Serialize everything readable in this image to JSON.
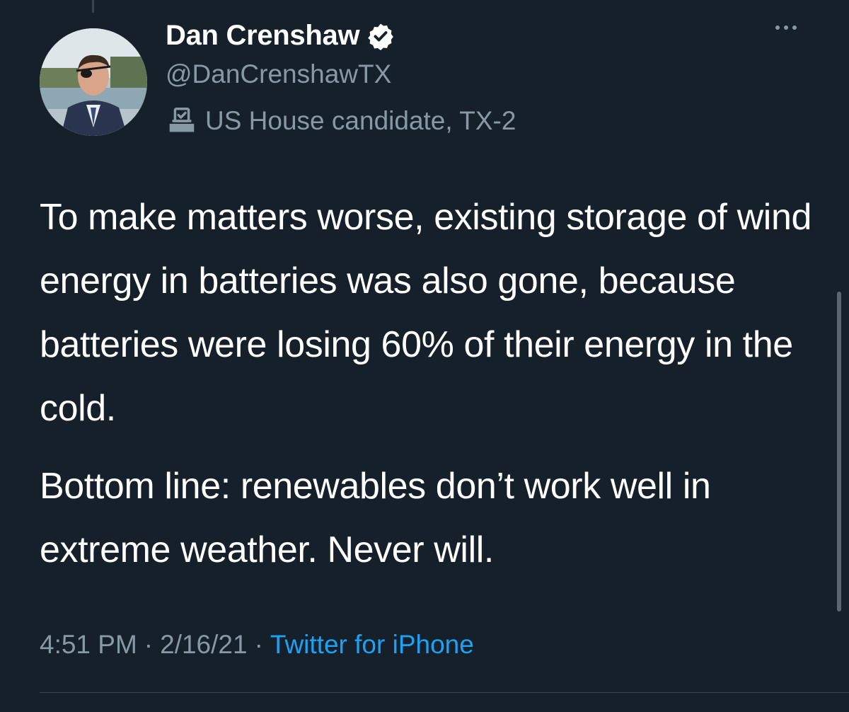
{
  "tweet": {
    "author": {
      "display_name": "Dan Crenshaw",
      "verified": true,
      "handle": "@DanCrenshawTX",
      "label": "US House candidate, TX-2"
    },
    "text_paragraphs": [
      "To make matters worse, existing storage of wind energy in batteries was also gone, because batteries were losing 60% of their energy in the cold.",
      "Bottom line: renewables don’t work well in extreme weather. Never will."
    ],
    "time": "4:51 PM",
    "separator": "·",
    "date": "2/16/21",
    "source": "Twitter for iPhone"
  },
  "colors": {
    "background": "#15202b",
    "primary_text": "#ffffff",
    "secondary_text": "#8899a6",
    "link": "#1da1f2",
    "divider": "#38444d"
  },
  "icons": {
    "verified": "verified-badge-icon",
    "label": "ballot-box-icon",
    "more": "more-options-icon"
  }
}
